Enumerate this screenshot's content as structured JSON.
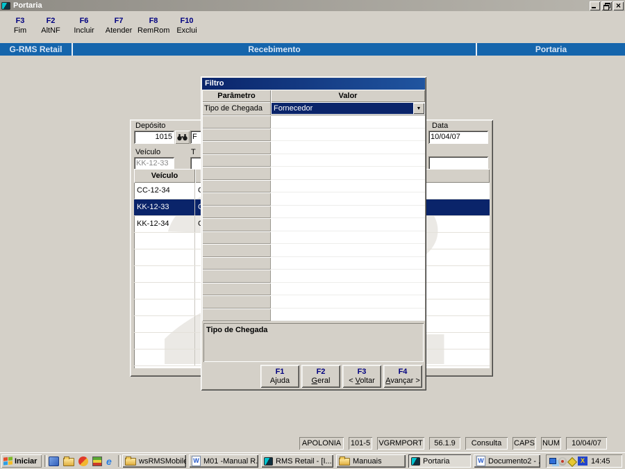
{
  "window": {
    "title": "Portaria",
    "app_icon": "rms-logo-icon",
    "controls": [
      "minimize-icon",
      "restore-icon",
      "close-icon"
    ]
  },
  "toolbar": {
    "items": [
      {
        "fkey": "F3",
        "label": "Fim"
      },
      {
        "fkey": "F2",
        "label": "AltNF"
      },
      {
        "fkey": "F6",
        "label": "Incluir"
      },
      {
        "fkey": "F7",
        "label": "Atender"
      },
      {
        "fkey": "F8",
        "label": "RemRom"
      },
      {
        "fkey": "F10",
        "label": "Exclui"
      }
    ]
  },
  "banner": {
    "left": "G-RMS Retail",
    "center": "Recebimento",
    "right": "Portaria"
  },
  "form": {
    "deposito_label": "Depósito",
    "deposito_value": "1015",
    "truncated_field_top": "F",
    "veiculo_label": "Veículo",
    "veiculo_value": "KK-12-33",
    "truncated_label_mid": "T",
    "data_label": "Data",
    "data_value": "10/04/07",
    "table": {
      "col1_header": "Veículo",
      "col2_header": "",
      "watermark": "2",
      "rows": [
        {
          "veiculo": "CC-12-34",
          "col2": "CA",
          "selected": false
        },
        {
          "veiculo": "KK-12-33",
          "col2": "CA",
          "selected": true
        },
        {
          "veiculo": "KK-12-34",
          "col2": "CA",
          "selected": false
        }
      ],
      "empty_rows": 8
    }
  },
  "dialog": {
    "title": "Filtro",
    "headers": {
      "param": "Parâmetro",
      "value": "Valor"
    },
    "rows": [
      {
        "param": "Tipo de Chegada",
        "value": "Fornecedor"
      }
    ],
    "empty_rows": 16,
    "description": "Tipo de Chegada",
    "buttons": [
      {
        "fkey": "F1",
        "pre": "",
        "key": "",
        "post": "Ajuda"
      },
      {
        "fkey": "F2",
        "pre": "",
        "key": "G",
        "post": "eral"
      },
      {
        "fkey": "F3",
        "pre": "< ",
        "key": "V",
        "post": "oltar"
      },
      {
        "fkey": "F4",
        "pre": "",
        "key": "A",
        "post": "vançar >"
      }
    ]
  },
  "statusbar": {
    "panels": [
      "APOLONIA",
      "101-5",
      "VGRMPORT",
      "56.1.9",
      "Consulta",
      "CAPS",
      "NUM",
      "10/04/07"
    ]
  },
  "taskbar": {
    "start_label": "Iniciar",
    "quick_launch": [
      "outlook-icon",
      "folder-icon",
      "media-icon",
      "desktop-icon",
      "ie-icon"
    ],
    "tasks": [
      {
        "icon": "folder-icon",
        "label": "wsRMSMobile",
        "active": false
      },
      {
        "icon": "word-icon",
        "label": "M01 -Manual R...",
        "active": false
      },
      {
        "icon": "rms-icon",
        "label": "RMS Retail - [I...",
        "active": false
      },
      {
        "icon": "folder-icon",
        "label": "Manuais",
        "active": false
      },
      {
        "icon": "rms-icon",
        "label": "Portaria",
        "active": true
      },
      {
        "icon": "word-icon",
        "label": "Documento2 - ...",
        "active": false
      }
    ],
    "tray_icons": [
      "network-icon",
      "agent-icon",
      "pencil-icon",
      "x30-icon"
    ],
    "clock": "14:45"
  }
}
